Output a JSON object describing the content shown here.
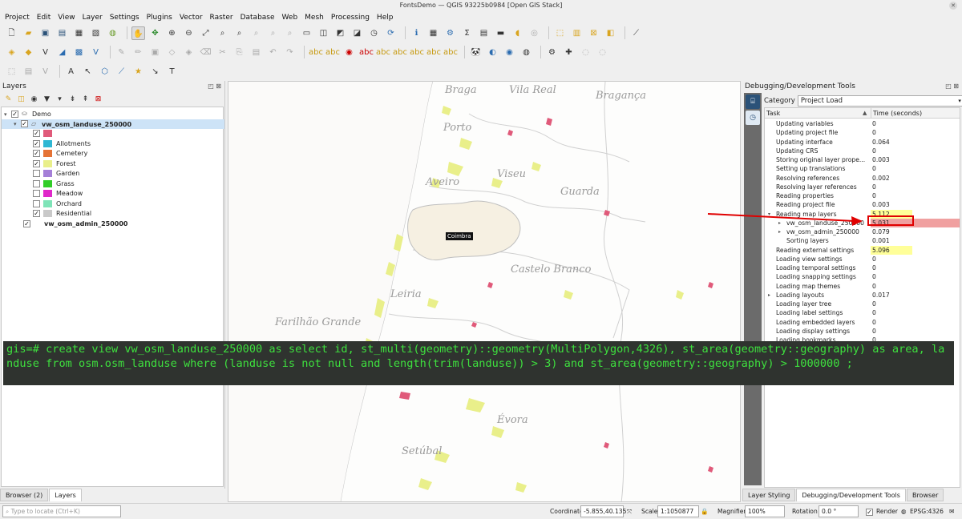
{
  "window": {
    "title": "FontsDemo — QGIS 93225b0984 [Open GIS Stack]"
  },
  "menu": [
    "Project",
    "Edit",
    "View",
    "Layer",
    "Settings",
    "Plugins",
    "Vector",
    "Raster",
    "Database",
    "Web",
    "Mesh",
    "Processing",
    "Help"
  ],
  "layers_panel": {
    "title": "Layers",
    "group": "Demo",
    "landuse_layer": "vw_osm_landuse_250000",
    "categories": [
      {
        "label": "",
        "color": "#e05a7a",
        "checked": true
      },
      {
        "label": "Allotments",
        "color": "#2fb7d3",
        "checked": true
      },
      {
        "label": "Cemetery",
        "color": "#e57336",
        "checked": true
      },
      {
        "label": "Forest",
        "color": "#e9ef8a",
        "checked": true
      },
      {
        "label": "Garden",
        "color": "#a57fd8",
        "checked": false
      },
      {
        "label": "Grass",
        "color": "#31cd28",
        "checked": false
      },
      {
        "label": "Meadow",
        "color": "#e028c9",
        "checked": false
      },
      {
        "label": "Orchard",
        "color": "#7fe4b8",
        "checked": false
      },
      {
        "label": "Residential",
        "color": "#c9c9c9",
        "checked": true
      }
    ],
    "admin_layer": "vw_osm_admin_250000",
    "tabs": [
      "Browser (2)",
      "Layers"
    ]
  },
  "map": {
    "labels": [
      "Braga",
      "Vila Real",
      "Bragança",
      "Porto",
      "Aveiro",
      "Viseu",
      "Guarda",
      "Castelo Branco",
      "Leiria",
      "Farilhão Grande",
      "Évora",
      "Setúbal"
    ],
    "highlight_label": "Coimbra"
  },
  "sql": {
    "text": "gis=# create view vw_osm_landuse_250000 as select id, st_multi(geometry)::geometry(MultiPolygon,4326), st_area(geometry::geography) as area, landuse from osm.osm_landuse where (landuse is not null and length(trim(landuse)) > 3) and st_area(geometry::geography) > 1000000 ;"
  },
  "debug_panel": {
    "title": "Debugging/Development Tools",
    "category_label": "Category",
    "category_value": "Project Load",
    "col_task": "Task",
    "col_time": "Time (seconds)",
    "rows": [
      {
        "task": "Updating variables",
        "time": "0"
      },
      {
        "task": "Updating project file",
        "time": "0"
      },
      {
        "task": "Updating interface",
        "time": "0.064"
      },
      {
        "task": "Updating CRS",
        "time": "0"
      },
      {
        "task": "Storing original layer prope...",
        "time": "0.003"
      },
      {
        "task": "Setting up translations",
        "time": "0"
      },
      {
        "task": "Resolving references",
        "time": "0.002"
      },
      {
        "task": "Resolving layer references",
        "time": "0"
      },
      {
        "task": "Reading properties",
        "time": "0"
      },
      {
        "task": "Reading project file",
        "time": "0.003"
      },
      {
        "task": "Reading map layers",
        "time": "5.112"
      },
      {
        "task": "vw_osm_landuse_250000",
        "time": "5.031"
      },
      {
        "task": "vw_osm_admin_250000",
        "time": "0.079"
      },
      {
        "task": "Sorting layers",
        "time": "0.001"
      },
      {
        "task": "Reading external settings",
        "time": "5.096"
      },
      {
        "task": "Loading view settings",
        "time": "0"
      },
      {
        "task": "Loading temporal settings",
        "time": "0"
      },
      {
        "task": "Loading snapping settings",
        "time": "0"
      },
      {
        "task": "Loading map themes",
        "time": "0"
      },
      {
        "task": "Loading layouts",
        "time": "0.017"
      },
      {
        "task": "Loading layer tree",
        "time": "0"
      },
      {
        "task": "Loading label settings",
        "time": "0"
      },
      {
        "task": "Loading embedded layers",
        "time": "0"
      },
      {
        "task": "Loading display settings",
        "time": "0"
      },
      {
        "task": "Loading bookmarks",
        "time": "0"
      }
    ],
    "tabs": [
      "Layer Styling",
      "Debugging/Development Tools",
      "Browser"
    ]
  },
  "statusbar": {
    "locate_placeholder": "Type to locate (Ctrl+K)",
    "coordinate_label": "Coordinate",
    "coordinate_value": "-5.855,40.135",
    "scale_label": "Scale",
    "scale_value": "1:1050877",
    "magnifier_label": "Magnifier",
    "magnifier_value": "100%",
    "rotation_label": "Rotation",
    "rotation_value": "0.0 °",
    "render_label": "Render",
    "crs_value": "EPSG:4326"
  },
  "colors": {
    "selection": "#cde3f7",
    "highlight_yellow": "#ffff99",
    "highlight_red": "#f0a0a0",
    "sql_text": "#3ee03e",
    "sql_bg": "#2f332f",
    "annotation_red": "#e00000"
  }
}
